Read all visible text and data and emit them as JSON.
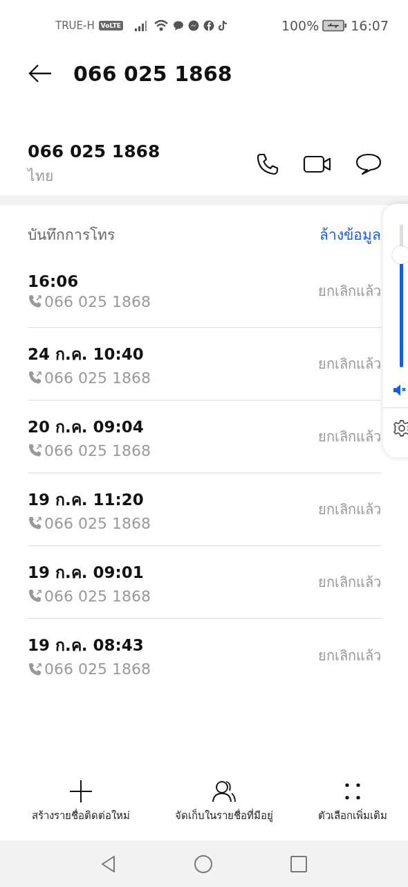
{
  "status_bar": {
    "carrier": "TRUE-H",
    "volte": "VoLTE",
    "battery": "100%",
    "time": "16:07"
  },
  "header": {
    "title": "066 025 1868"
  },
  "contact": {
    "number": "066 025 1868",
    "region": "ไทย"
  },
  "call_log": {
    "title": "บันทึกการโทร",
    "clear": "ล้างข้อมูล",
    "rows": [
      {
        "time": "16:06",
        "number": "066 025 1868",
        "status": "ยกเลิกแล้ว"
      },
      {
        "time": "24 ก.ค. 10:40",
        "number": "066 025 1868",
        "status": "ยกเลิกแล้ว"
      },
      {
        "time": "20 ก.ค. 09:04",
        "number": "066 025 1868",
        "status": "ยกเลิกแล้ว"
      },
      {
        "time": "19 ก.ค. 11:20",
        "number": "066 025 1868",
        "status": "ยกเลิกแล้ว"
      },
      {
        "time": "19 ก.ค. 09:01",
        "number": "066 025 1868",
        "status": "ยกเลิกแล้ว"
      },
      {
        "time": "19 ก.ค. 08:43",
        "number": "066 025 1868",
        "status": "ยกเลิกแล้ว"
      }
    ]
  },
  "volume_panel": {
    "level": 0.78
  },
  "bottom_actions": [
    {
      "kind": "add",
      "label": "สร้างรายชื่อติดต่อใหม่"
    },
    {
      "kind": "contact",
      "label": "จัดเก็บในรายชื่อที่มีอยู่"
    },
    {
      "kind": "more",
      "label": "ตัวเลือกเพิ่มเติม"
    }
  ]
}
